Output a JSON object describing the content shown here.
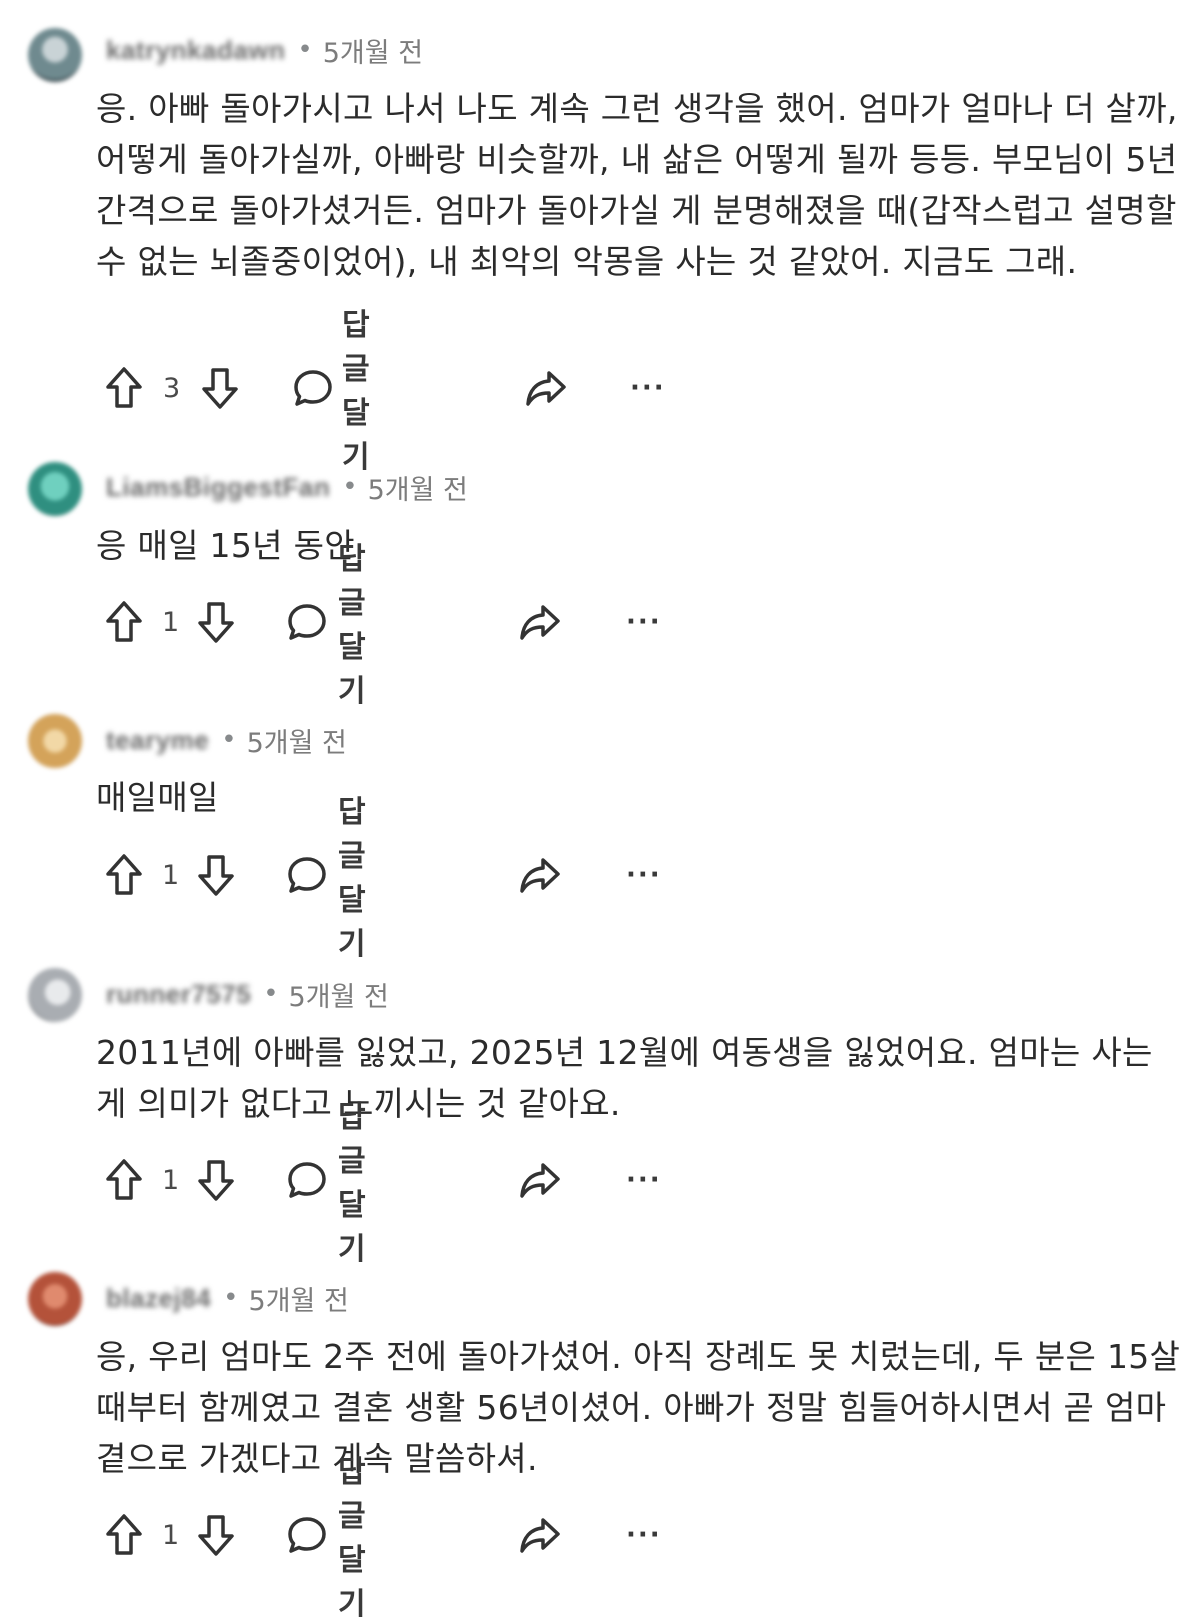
{
  "comments": [
    {
      "username": "katrynkadawn",
      "time": "5개월 전",
      "avatar_color": "#6f8a8f",
      "text": "응. 아빠 돌아가시고 나서 나도 계속 그런 생각을 했어. 엄마가 얼마나 더 살까, 어떻게 돌아가실까, 아빠랑 비슷할까, 내 삶은 어떻게 될까 등등. 부모님이 5년 간격으로 돌아가셨거든. 엄마가 돌아가실 게 분명해졌을 때(갑작스럽고 설명할 수 없는 뇌졸중이었어), 내 최악의 악몽을 사는 것 같았어. 지금도 그래.",
      "votes": "3",
      "reply_label": "답글 달기",
      "more_label": "···"
    },
    {
      "username": "LiamsBiggestFan",
      "time": "5개월 전",
      "avatar_color": "#3a9a8a",
      "text": "응 매일 15년 동안",
      "votes": "1",
      "reply_label": "답글 달기",
      "more_label": "···"
    },
    {
      "username": "tearyme",
      "time": "5개월 전",
      "avatar_color": "#d4a35a",
      "text": "매일매일",
      "votes": "1",
      "reply_label": "답글 달기",
      "more_label": "···"
    },
    {
      "username": "runner7575",
      "time": "5개월 전",
      "avatar_color": "#a9adb2",
      "text": "2011년에 아빠를 잃었고, 2025년 12월에 여동생을 잃었어요. 엄마는 사는 게 의미가 없다고 느끼시는 것 같아요.",
      "votes": "1",
      "reply_label": "답글 달기",
      "more_label": "···"
    },
    {
      "username": "blazej84",
      "time": "5개월 전",
      "avatar_color": "#b4523a",
      "text": "응, 우리 엄마도 2주 전에 돌아가셨어. 아직 장례도 못 치렀는데, 두 분은 15살 때부터 함께였고 결혼 생활 56년이셨어. 아빠가 정말 힘들어하시면서 곧 엄마 곁으로 가겠다고 계속 말씀하셔.",
      "votes": "1",
      "reply_label": "답글 달기",
      "more_label": "···"
    }
  ]
}
